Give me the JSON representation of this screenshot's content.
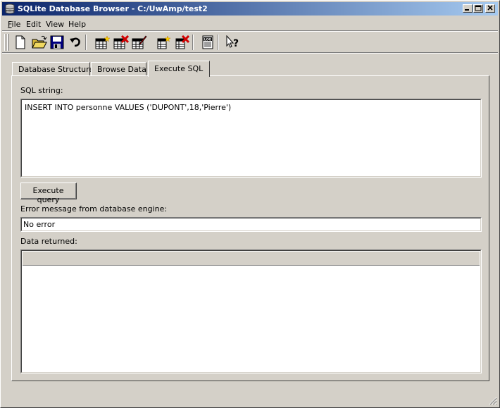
{
  "window": {
    "title": "SQLite Database Browser - C:/UwAmp/test2"
  },
  "menu": {
    "items": [
      {
        "label": "File",
        "underline": "F",
        "rest": "ile"
      },
      {
        "label": "Edit",
        "underline": "",
        "rest": "Edit"
      },
      {
        "label": "View",
        "underline": "",
        "rest": "View"
      },
      {
        "label": "Help",
        "underline": "",
        "rest": "Help"
      }
    ]
  },
  "toolbar": {
    "icons": [
      "new-database-icon",
      "open-database-icon",
      "save-icon",
      "undo-icon",
      "create-table-icon",
      "delete-table-icon",
      "modify-table-icon",
      "create-index-icon",
      "delete-index-icon",
      "log-icon",
      "whats-this-icon"
    ]
  },
  "tabs": [
    {
      "label": "Database Structure",
      "active": false
    },
    {
      "label": "Browse Data",
      "active": false
    },
    {
      "label": "Execute SQL",
      "active": true
    }
  ],
  "execute": {
    "sql_label": "SQL string:",
    "sql_value": "INSERT INTO personne VALUES ('DUPONT',18,'Pierre')",
    "execute_button": "Execute query",
    "error_label": "Error message from database engine:",
    "error_value": "No error",
    "data_label": "Data returned:"
  },
  "colors": {
    "titlebar_start": "#0a246a",
    "titlebar_end": "#a6caf0",
    "face": "#d4d0c8"
  }
}
